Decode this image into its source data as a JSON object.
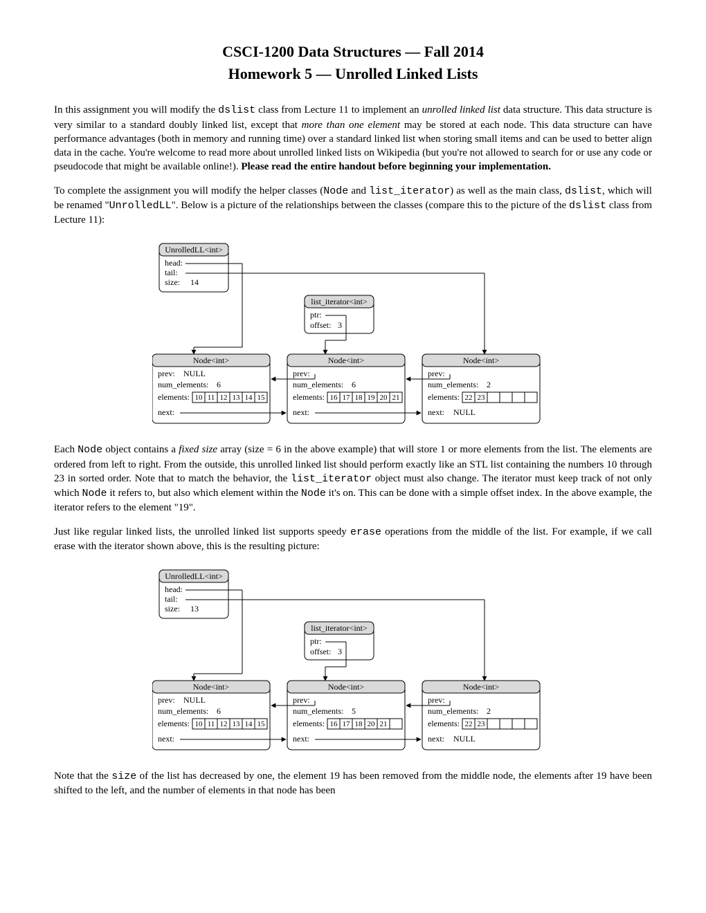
{
  "title": "CSCI-1200 Data Structures — Fall 2014",
  "subtitle": "Homework 5 — Unrolled Linked Lists",
  "para1": {
    "s1a": "In this assignment you will modify the ",
    "s1b": "dslist",
    "s1c": " class from Lecture 11 to implement an ",
    "s1d": "unrolled linked list",
    "s1e": " data structure. This data structure is very similar to a standard doubly linked list, except that ",
    "s1f": "more than one element",
    "s1g": " may be stored at each node. This data structure can have performance advantages (both in memory and running time) over a standard linked list when storing small items and can be used to better align data in the cache. You're welcome to read more about unrolled linked lists on Wikipedia (but you're not allowed to search for or use any code or pseudocode that might be available online!). ",
    "s1h": "Please read the entire handout before beginning your implementation."
  },
  "para2": {
    "s2a": "To complete the assignment you will modify the helper classes (",
    "s2b": "Node",
    "s2c": " and ",
    "s2d": "list_iterator",
    "s2e": ") as well as the main class, ",
    "s2f": "dslist",
    "s2g": ", which will be renamed \"",
    "s2h": "UnrolledLL",
    "s2i": "\". Below is a picture of the relationships between the classes (compare this to the picture of the ",
    "s2j": "dslist",
    "s2k": " class from Lecture 11):"
  },
  "fig1": {
    "unrolled_label": "UnrolledLL<int>",
    "head_label": "head:",
    "tail_label": "tail:",
    "size_label": "size:",
    "size_value": "14",
    "iter_label": "list_iterator<int>",
    "ptr_label": "ptr:",
    "offset_label": "offset:",
    "offset_value": "3",
    "node_label": "Node<int>",
    "prev_label": "prev:",
    "null_text": "NULL",
    "num_elem_label": "num_elements:",
    "elements_label": "elements:",
    "next_label": "next:",
    "node1": {
      "num": "6",
      "cells": [
        "10",
        "11",
        "12",
        "13",
        "14",
        "15"
      ]
    },
    "node2": {
      "num": "6",
      "cells": [
        "16",
        "17",
        "18",
        "19",
        "20",
        "21"
      ]
    },
    "node3": {
      "num": "2",
      "cells": [
        "22",
        "23",
        "",
        "",
        "",
        ""
      ]
    }
  },
  "para3": {
    "s3a": "Each ",
    "s3b": "Node",
    "s3c": " object contains a ",
    "s3d": "fixed size",
    "s3e": " array (size = 6 in the above example) that will store 1 or more elements from the list. The elements are ordered from left to right. From the outside, this unrolled linked list should perform exactly like an STL list containing the numbers 10 through 23 in sorted order. Note that to match the behavior, the ",
    "s3f": "list_iterator",
    "s3g": " object must also change. The iterator must keep track of not only which ",
    "s3h": "Node",
    "s3i": " it refers to, but also which element within the ",
    "s3j": "Node",
    "s3k": " it's on. This can be done with a simple offset index. In the above example, the iterator refers to the element \"19\"."
  },
  "para4": {
    "s4a": "Just like regular linked lists, the unrolled linked list supports speedy ",
    "s4b": "erase",
    "s4c": " operations from the middle of the list. For example, if we call erase with the iterator shown above, this is the resulting picture:"
  },
  "fig2": {
    "size_value": "13",
    "offset_value": "3",
    "node1": {
      "num": "6",
      "cells": [
        "10",
        "11",
        "12",
        "13",
        "14",
        "15"
      ]
    },
    "node2": {
      "num": "5",
      "cells": [
        "16",
        "17",
        "18",
        "20",
        "21",
        ""
      ]
    },
    "node3": {
      "num": "2",
      "cells": [
        "22",
        "23",
        "",
        "",
        "",
        ""
      ]
    }
  },
  "para5": {
    "s5a": "Note that the ",
    "s5b": "size",
    "s5c": " of the list has decreased by one, the element 19 has been removed from the middle node, the elements after 19 have been shifted to the left, and the number of elements in that node has been"
  }
}
